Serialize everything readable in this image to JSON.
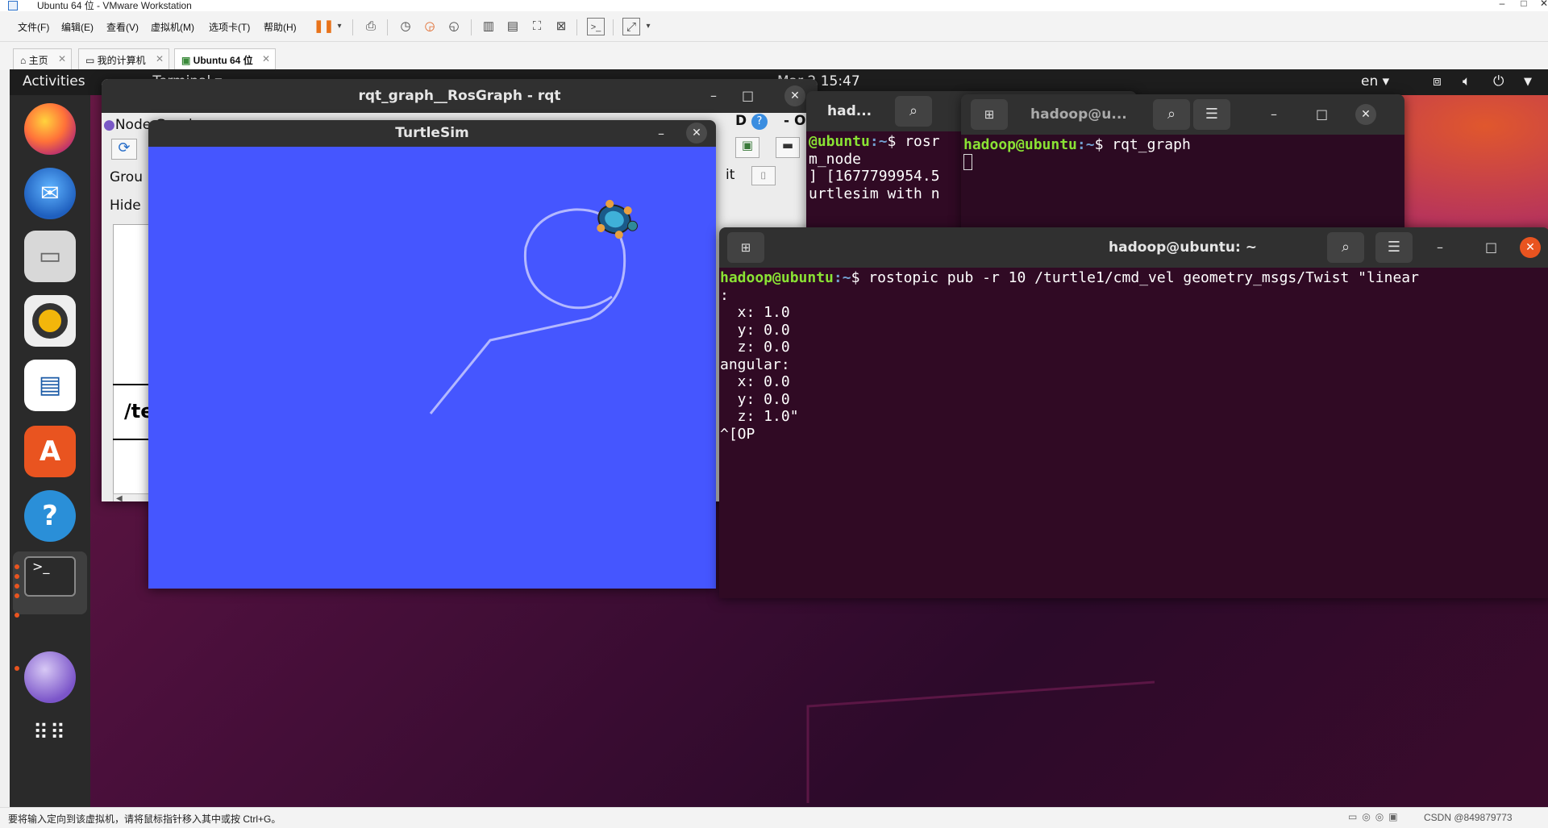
{
  "vmware": {
    "window_title": "Ubuntu 64 位 - VMware Workstation",
    "menu": [
      "文件(F)",
      "编辑(E)",
      "查看(V)",
      "虚拟机(M)",
      "选项卡(T)",
      "帮助(H)"
    ],
    "tabs": [
      {
        "label": "主页",
        "icon": "home-icon"
      },
      {
        "label": "我的计算机",
        "icon": "computer-icon"
      },
      {
        "label": "Ubuntu 64 位",
        "icon": "vm-icon",
        "active": true
      }
    ],
    "status_text": "要将输入定向到该虚拟机，请将鼠标指针移入其中或按 Ctrl+G。",
    "watermark": "CSDN @849879773"
  },
  "ubuntu": {
    "activities": "Activities",
    "app_menu": "Terminal",
    "clock": "Mar 2  15:47",
    "lang": "en",
    "dock": [
      {
        "name": "firefox-icon"
      },
      {
        "name": "thunderbird-icon"
      },
      {
        "name": "files-icon"
      },
      {
        "name": "rhythmbox-icon"
      },
      {
        "name": "writer-icon"
      },
      {
        "name": "software-icon"
      },
      {
        "name": "help-icon"
      },
      {
        "name": "terminal-icon"
      },
      {
        "name": "rviz-icon"
      },
      {
        "name": "apps-grid-icon"
      }
    ]
  },
  "rqt": {
    "title": "rqt_graph__RosGraph - rqt",
    "plugin_title": "Node Graph",
    "group_label": "Grou",
    "hide_label": "Hide",
    "fit_label": "it",
    "node_text": "/te",
    "dock_right": "D",
    "dock_o": "- O"
  },
  "turtlesim": {
    "title": "TurtleSim",
    "bg_color": "#4556ff"
  },
  "term_back": {
    "title": "had...",
    "lines": [
      {
        "user": "@ubuntu",
        "path": ":~",
        "cmd": "$ rosr"
      },
      {
        "text": "m_node"
      },
      {
        "text": "] [1677799954.5"
      },
      {
        "text": "urtlesim with n"
      }
    ]
  },
  "term_mid": {
    "title": "hadoop@u...",
    "user": "hadoop@ubuntu",
    "path": ":~",
    "cmd": "$ rqt_graph"
  },
  "term_front": {
    "title": "hadoop@ubuntu: ~",
    "user": "hadoop@ubuntu",
    "path": ":~",
    "cmd": "$ rostopic pub -r 10 /turtle1/cmd_vel geometry_msgs/Twist \"linear",
    "output": ":\n  x: 1.0\n  y: 0.0\n  z: 0.0\nangular:\n  x: 0.0\n  y: 0.0\n  z: 1.0\"\n^[OP"
  }
}
